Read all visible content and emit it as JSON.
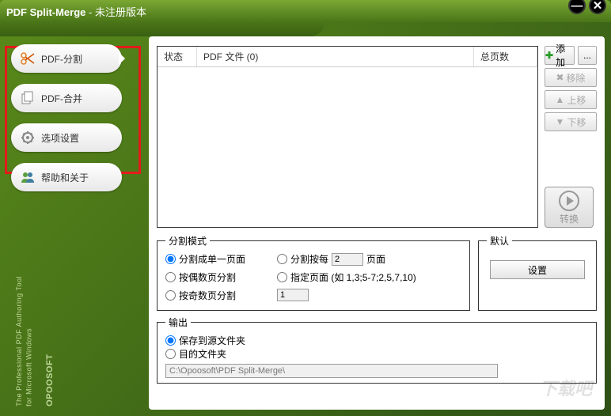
{
  "title": {
    "app": "PDF Split-Merge",
    "sep": " - ",
    "status": "未注册版本"
  },
  "sidebar": {
    "items": [
      {
        "label": "PDF-分割"
      },
      {
        "label": "PDF-合并"
      },
      {
        "label": "选项设置"
      },
      {
        "label": "帮助和关于"
      }
    ]
  },
  "vtext": {
    "line1": "The Professional PDF Authoring Tool",
    "line2": "for Microsoft Windows",
    "brand": "OPOOSOFT"
  },
  "filelist": {
    "col_status": "状态",
    "col_file": "PDF 文件 (0)",
    "col_pages": "总页数"
  },
  "sidebtns": {
    "add": "添加",
    "more": "...",
    "remove": "移除",
    "up": "上移",
    "down": "下移",
    "convert": "转换"
  },
  "split": {
    "legend": "分割模式",
    "r1": "分割成单一页面",
    "r2": "按偶数页分割",
    "r3": "按奇数页分割",
    "r4": "分割按每",
    "r4_val": "2",
    "r4_unit": "页面",
    "r5": "指定页面 (如 1,3;5-7;2,5,7,10)",
    "r5_val": "1"
  },
  "defaults": {
    "legend": "默认",
    "btn": "设置"
  },
  "output": {
    "legend": "输出",
    "r1": "保存到源文件夹",
    "r2": "目的文件夹",
    "path": "C:\\Opoosoft\\PDF Split-Merge\\"
  },
  "watermark": "下载吧"
}
